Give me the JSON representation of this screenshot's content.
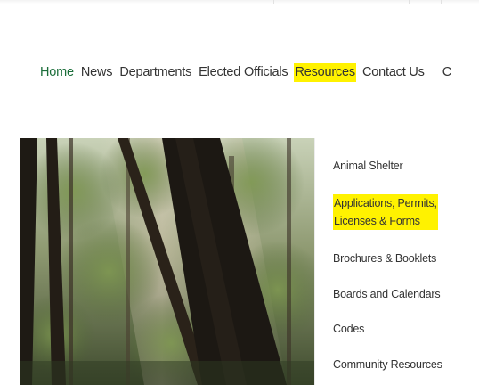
{
  "nav": {
    "items": [
      {
        "label": "Home",
        "state": "active"
      },
      {
        "label": "News",
        "state": "normal"
      },
      {
        "label": "Departments",
        "state": "normal"
      },
      {
        "label": "Elected Officials",
        "state": "normal"
      },
      {
        "label": "Resources",
        "state": "highlighted"
      },
      {
        "label": "Contact Us",
        "state": "normal"
      },
      {
        "label": "C",
        "state": "cutoff"
      }
    ]
  },
  "dropdown": {
    "items": [
      {
        "label": "Animal Shelter"
      },
      {
        "label_line1": "Applications, Permits,",
        "label_line2": "Licenses & Forms",
        "highlighted": true
      },
      {
        "label": "Brochures & Booklets"
      },
      {
        "label": "Boards and Calendars"
      },
      {
        "label": "Codes"
      },
      {
        "label": "Community Resources"
      }
    ]
  },
  "colors": {
    "active_nav": "#1b6e3a",
    "highlight": "#fff200",
    "text": "#333333"
  },
  "hero_image": "forest-trees-photo"
}
